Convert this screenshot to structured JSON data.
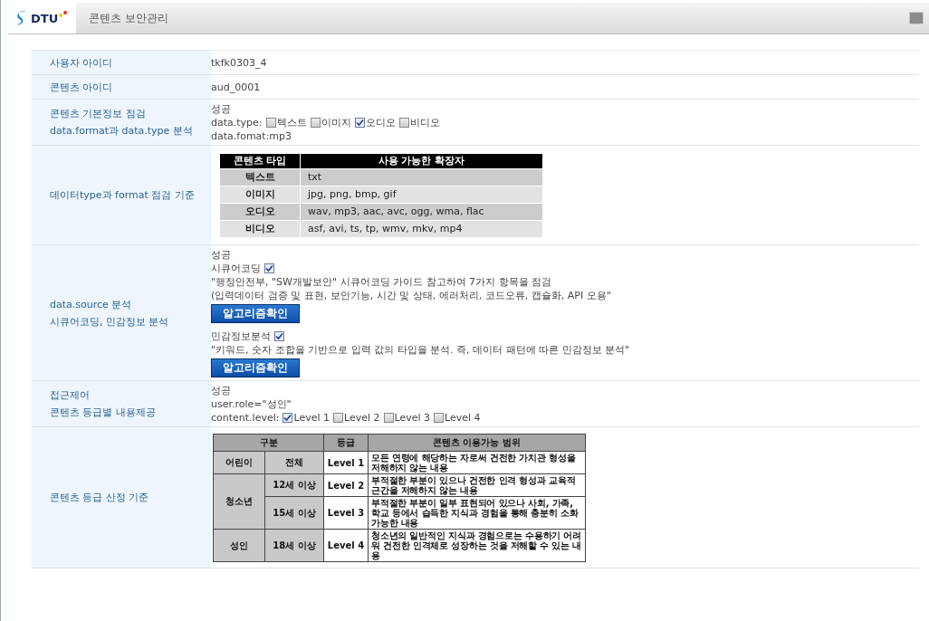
{
  "header": {
    "logo": "DTU",
    "title": "콘텐츠 보안관리"
  },
  "rows": [
    {
      "kind": "text",
      "label": [
        "사용자 아이디"
      ],
      "value": "tkfk0303_4"
    },
    {
      "kind": "text",
      "label": [
        "콘텐츠 아이디"
      ],
      "value": "aud_0001"
    },
    {
      "kind": "checks",
      "label": [
        "콘텐츠 기본정보 점검",
        "data.format과 data.type 분석"
      ],
      "status": "성공",
      "lines": [],
      "prefix": "data.type:",
      "options": [
        {
          "label": "텍스트",
          "checked": false
        },
        {
          "label": "이미지",
          "checked": false
        },
        {
          "label": "오디오",
          "checked": true
        },
        {
          "label": "비디오",
          "checked": false
        }
      ],
      "note": "data.fomat:mp3"
    },
    {
      "kind": "ext_table",
      "label": [
        "데이터type과 format 점검 기준"
      ],
      "columns": [
        "콘텐츠 타입",
        "사용 가능한 확장자"
      ],
      "rows": [
        {
          "type": "텍스트",
          "ext": "txt"
        },
        {
          "type": "이미지",
          "ext": "jpg, png, bmp, gif"
        },
        {
          "type": "오디오",
          "ext": "wav, mp3, aac, avc, ogg, wma, flac"
        },
        {
          "type": "비디오",
          "ext": "asf, avi, ts, tp, wmv, mkv, mp4"
        }
      ]
    },
    {
      "kind": "source",
      "label": [
        "data.source 분석",
        "시큐어코딩, 민감정보 분석"
      ],
      "status": "성공",
      "sections": [
        {
          "title": "시큐어코딩",
          "checked": true,
          "lines": [
            "\"행정안전부, \"SW개발보안\" 시큐어코딩 가이드 참고하여 7가지 항목을 점검",
            "(입력데이터 검증 및 표현, 보안기능, 시간 및 상태, 에러처리, 코드오류, 캡슐화, API 오용\""
          ],
          "button": "알고리즘확인"
        },
        {
          "title": "민감정보분석",
          "checked": true,
          "lines": [
            "\"키워드, 숫자 조합을 기반으로 입력 값의 타입을 분석. 즉, 데이터 패턴에 따른 민감정보 분석\""
          ],
          "button": "알고리즘확인"
        }
      ]
    },
    {
      "kind": "checks",
      "label": [
        "접근제어",
        "콘텐츠 등급별 내용제공"
      ],
      "status": "성공",
      "lines": [
        "user.role=\"성인\""
      ],
      "prefix": "content.level:",
      "options": [
        {
          "label": "Level 1",
          "checked": true
        },
        {
          "label": "Level 2",
          "checked": false
        },
        {
          "label": "Level 3",
          "checked": false
        },
        {
          "label": "Level 4",
          "checked": false
        }
      ]
    },
    {
      "kind": "grade_table",
      "label": [
        "콘텐츠 등급 산정 기준"
      ],
      "columns": [
        "구분",
        "등급",
        "콘텐츠 이용가능 범위"
      ],
      "groups": [
        {
          "name": "어린이",
          "rows": [
            {
              "age": "전체",
              "level": "Level 1",
              "desc": "모든 연령에 해당하는 자로써 건전한 가치관 형성을 저해하지 않는 내용"
            }
          ]
        },
        {
          "name": "청소년",
          "rows": [
            {
              "age": "12세 이상",
              "level": "Level 2",
              "desc": "부적절한 부분이 있으나 건전한 인격 형성과 교육적 근간을 저해하지 않는 내용"
            },
            {
              "age": "15세 이상",
              "level": "Level 3",
              "desc": "부적절한 부분이 일부 표현되어 있으나 사회, 가족, 학교 등에서 습득한 지식과 경험을 통해 충분히 소화 가능한 내용"
            }
          ]
        },
        {
          "name": "성인",
          "rows": [
            {
              "age": "18세 이상",
              "level": "Level 4",
              "desc": "청소년의 일반적인 지식과 경험으로는 수용하기 어려워 건전한 인격체로 성장하는 것을 저해할 수 있는 내용"
            }
          ]
        }
      ]
    }
  ]
}
